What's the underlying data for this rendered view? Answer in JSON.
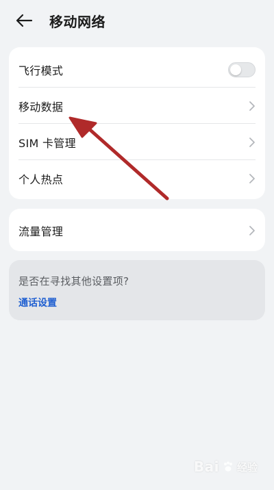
{
  "header": {
    "back_icon": "arrow-left-icon",
    "title": "移动网络"
  },
  "card1": {
    "items": [
      {
        "label": "飞行模式",
        "control": "toggle",
        "toggle_on": false
      },
      {
        "label": "移动数据",
        "control": "chevron-right-icon"
      },
      {
        "label": "SIM 卡管理",
        "control": "chevron-right-icon"
      },
      {
        "label": "个人热点",
        "control": "chevron-right-icon"
      }
    ]
  },
  "card2": {
    "items": [
      {
        "label": "流量管理",
        "control": "chevron-right-icon"
      }
    ]
  },
  "suggestion": {
    "question": "是否在寻找其他设置项?",
    "link": "通话设置"
  },
  "annotation": {
    "icon": "red-arrow-annotation",
    "color": "#b02a2a"
  },
  "watermark": {
    "brand": "Bai",
    "text": "经验"
  },
  "colors": {
    "background": "#f1f3f5",
    "card": "#ffffff",
    "link": "#1f5fd1"
  }
}
